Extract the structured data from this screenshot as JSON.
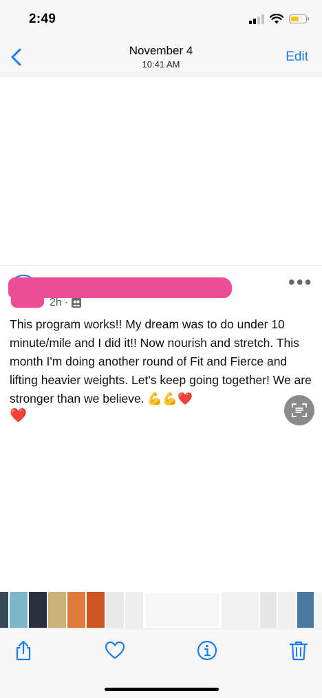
{
  "status_bar": {
    "time": "2:49",
    "signal": "cellular-signal-icon",
    "wifi": "wifi-icon",
    "battery": "battery-low-icon",
    "battery_color": "#f7c41b"
  },
  "nav": {
    "back_icon": "chevron-left-icon",
    "title": "November 4",
    "subtitle": "10:41 AM",
    "edit_label": "Edit",
    "accent_color": "#1a7cf5"
  },
  "post": {
    "time_ago": "2h",
    "separator": "·",
    "audience_icon": "friends-icon",
    "more_icon": "more-dots-icon",
    "text": "This program works!! My dream was to do under 10 minute/mile and I did it!! Now nourish and stretch. This month I'm doing another round of Fit and Fierce and lifting heavier weights. Let's keep going together! We are stronger than we believe. 💪💪❤️",
    "trailing_emoji": "❤️",
    "redaction_color": "#ee4d97"
  },
  "overlay": {
    "live_text_icon": "live-text-scan-icon"
  },
  "thumbnails": [
    "#3a4a5e",
    "#7bb6c9",
    "#2a3040",
    "#c9b27a",
    "#e07a3a",
    "#cc5522",
    "#e8e8e8",
    "#eeeeee",
    "#f6f6f6",
    "#f2f2f2",
    "#e6e6e6",
    "#efefef",
    "#4a78a0",
    "#f4f4f4",
    "#e0e0e0",
    "#f8f8f8"
  ],
  "toolbar": {
    "share_icon": "share-icon",
    "favorite_icon": "heart-icon",
    "info_icon": "info-icon",
    "delete_icon": "trash-icon"
  }
}
